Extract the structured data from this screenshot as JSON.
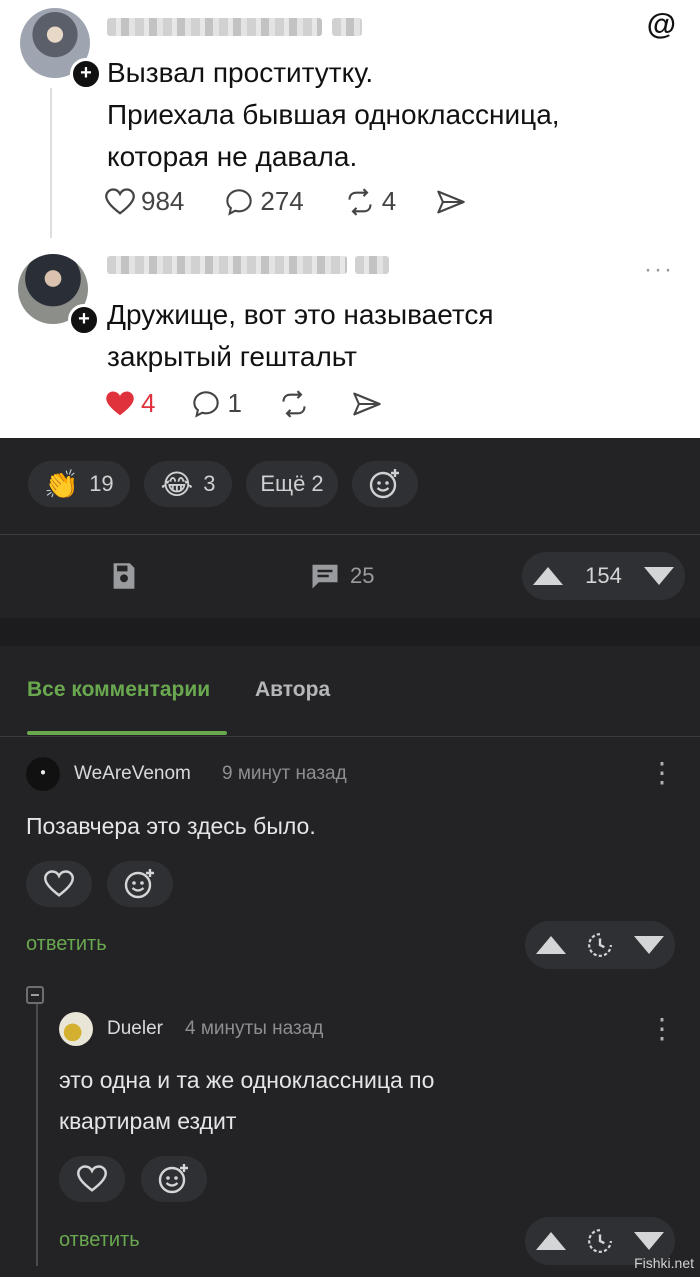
{
  "post1": {
    "lines": [
      "Вызвал проститутку.",
      "Приехала бывшая одноклассница,",
      "которая не давала."
    ],
    "likes": "984",
    "comments": "274",
    "reposts": "4"
  },
  "post2": {
    "lines": [
      "Дружище, вот это называется",
      "закрытый гештальт"
    ],
    "likes": "4",
    "comments": "1",
    "more": "···"
  },
  "reactions": {
    "clap_count": "19",
    "laugh_count": "3",
    "more_label": "Ещё 2"
  },
  "stats": {
    "comments_count": "25",
    "rating": "154"
  },
  "tabs": {
    "all": "Все комментарии",
    "author": "Автора"
  },
  "comments": [
    {
      "author": "WeAreVenom",
      "time": "9 минут назад",
      "text": "Позавчера это здесь было.",
      "reply": "ответить"
    },
    {
      "author": "Dueler",
      "time": "4 минуты назад",
      "lines": [
        "это одна и та же одноклассница по",
        "квартирам ездит"
      ],
      "reply": "ответить"
    }
  ],
  "watermark": "Fishki.net",
  "colors": {
    "accent": "#6aa84f",
    "background": "#232325",
    "heart": "#e0323c"
  }
}
